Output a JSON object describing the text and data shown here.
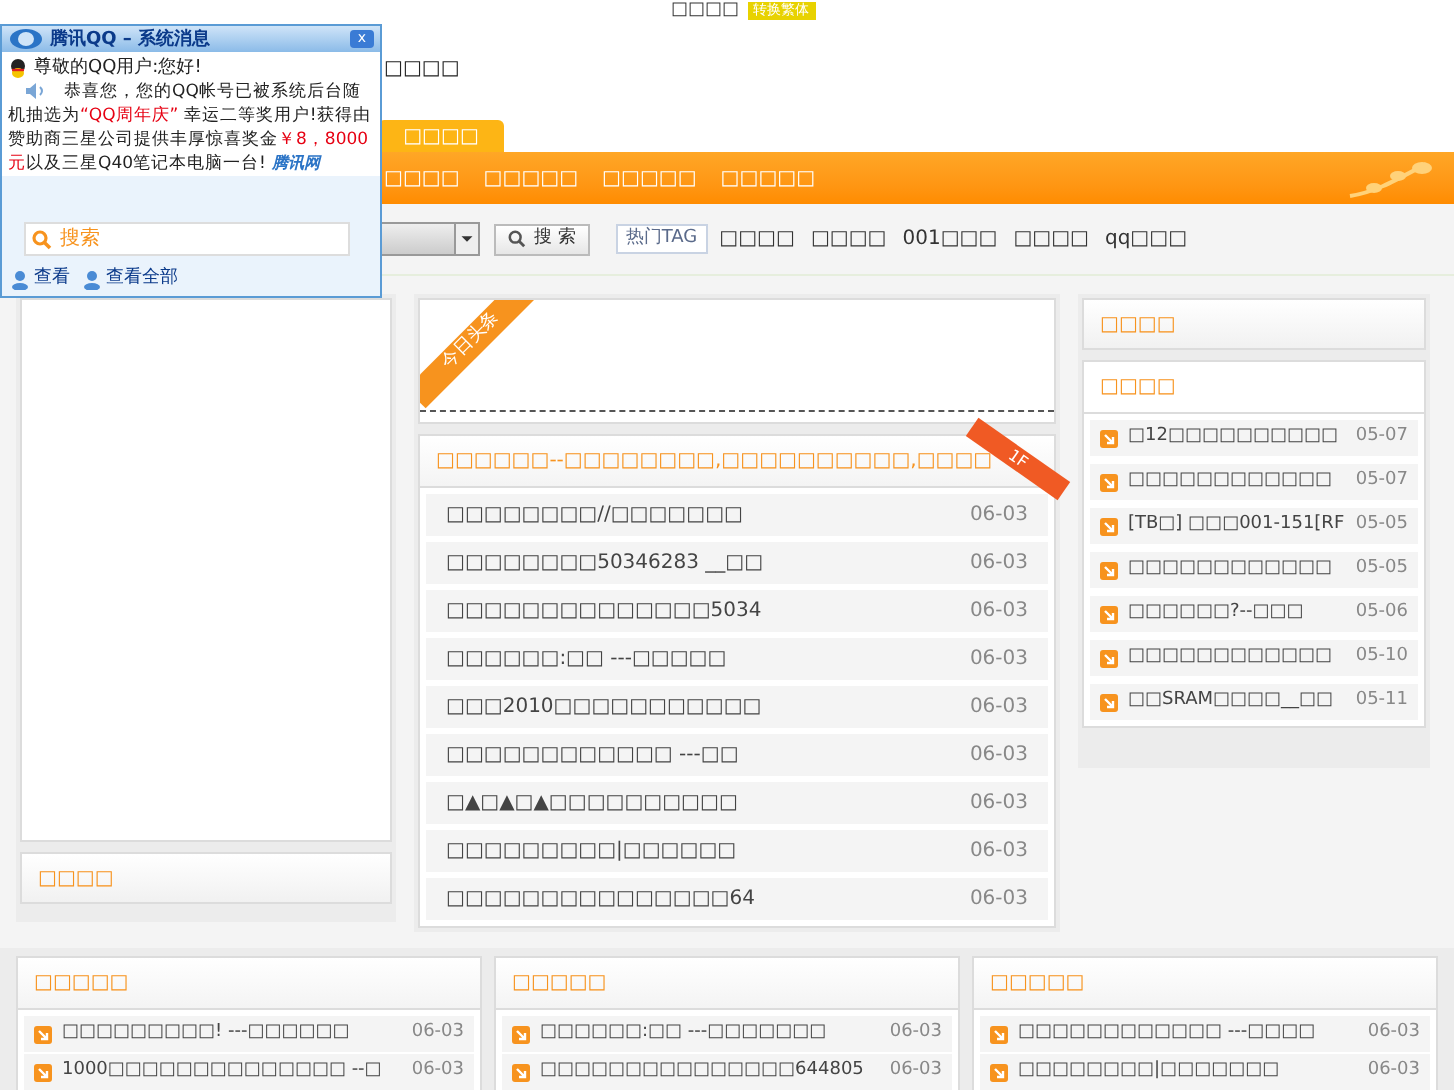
{
  "top_bar": {
    "text": "□□□□",
    "badge": "转换繁体"
  },
  "header": {
    "text": "□□□□"
  },
  "popup": {
    "title": "腾讯QQ – 系统消息",
    "close": "x",
    "greeting": "尊敬的QQ用户:您好!",
    "message": [
      {
        "kind": "normal",
        "text": "恭喜您，您的QQ帐号已被系统后台随机抽选为"
      },
      {
        "kind": "highlight",
        "text": "“QQ周年庆”"
      },
      {
        "kind": "normal",
        "text": " 幸运二等奖用户!获得由赞助商三星公司提供丰厚惊喜奖金"
      },
      {
        "kind": "highlight",
        "text": "￥8，8000元"
      },
      {
        "kind": "normal",
        "text": "以及三星Q40笔记本电脑一台!"
      }
    ],
    "logo": "腾讯网",
    "links": [
      "查看",
      "查看全部"
    ]
  },
  "nav": {
    "tab": "□□□□",
    "items": [
      "□□□□",
      "□□□□□",
      "□□□□□",
      "□□□□□"
    ]
  },
  "search": {
    "placeholder": "搜索",
    "button": "搜 索",
    "tag_label": "热门TAG",
    "tags": [
      "□□□□",
      "□□□□",
      "001□□□",
      "□□□□",
      "qq□□□"
    ]
  },
  "left": {
    "footer_title": "□□□□"
  },
  "headline": {
    "ribbon": "今日头条"
  },
  "feature": {
    "title": "□□□□□□--□□□□□□□□,□□□□□□□□□□,□□□□",
    "ribbon": "1F",
    "rows": [
      {
        "title": "□□□□□□□□//□□□□□□□",
        "date": "06-03"
      },
      {
        "title": "□□□□□□□□50346283 __□□",
        "date": "06-03"
      },
      {
        "title": "□□□□□□□□□□□□□□5034",
        "date": "06-03"
      },
      {
        "title": "□□□□□□:□□ ---□□□□□",
        "date": "06-03"
      },
      {
        "title": "□□□2010□□□□□□□□□□□",
        "date": "06-03"
      },
      {
        "title": "□□□□□□□□□□□□ ---□□",
        "date": "06-03"
      },
      {
        "title": "□▲□▲□▲□□□□□□□□□□",
        "date": "06-03"
      },
      {
        "title": "□□□□□□□□□|□□□□□□",
        "date": "06-03"
      },
      {
        "title": "□□□□□□□□□□□□□□□64",
        "date": "06-03"
      }
    ]
  },
  "right": {
    "top_title": "□□□□",
    "list_title": "□□□□",
    "rows": [
      {
        "title": "□12□□□□□□□□□□",
        "date": "05-07"
      },
      {
        "title": "□□□□□□□□□□□□",
        "date": "05-07"
      },
      {
        "title": "[TB□] □□□001-151[RF",
        "date": "05-05"
      },
      {
        "title": "□□□□□□□□□□□□",
        "date": "05-05"
      },
      {
        "title": "□□□□□□?--□□□",
        "date": "05-06"
      },
      {
        "title": "□□□□□□□□□□□□",
        "date": "05-10"
      },
      {
        "title": "□□SRAM□□□□__□□",
        "date": "05-11"
      }
    ]
  },
  "bottom": [
    {
      "title": "□□□□□",
      "rows": [
        {
          "title": "□□□□□□□□□! ---□□□□□□",
          "date": "06-03"
        },
        {
          "title": "1000□□□□□□□□□□□□□□ --□",
          "date": "06-03"
        }
      ]
    },
    {
      "title": "□□□□□",
      "rows": [
        {
          "title": "□□□□□□:□□ ---□□□□□□□",
          "date": "06-03"
        },
        {
          "title": "□□□□□□□□□□□□□□□644805",
          "date": "06-03"
        }
      ]
    },
    {
      "title": "□□□□□",
      "rows": [
        {
          "title": "□□□□□□□□□□□□ ---□□□□",
          "date": "06-03"
        },
        {
          "title": "□□□□□□□□|□□□□□□□",
          "date": "06-03"
        }
      ]
    }
  ]
}
